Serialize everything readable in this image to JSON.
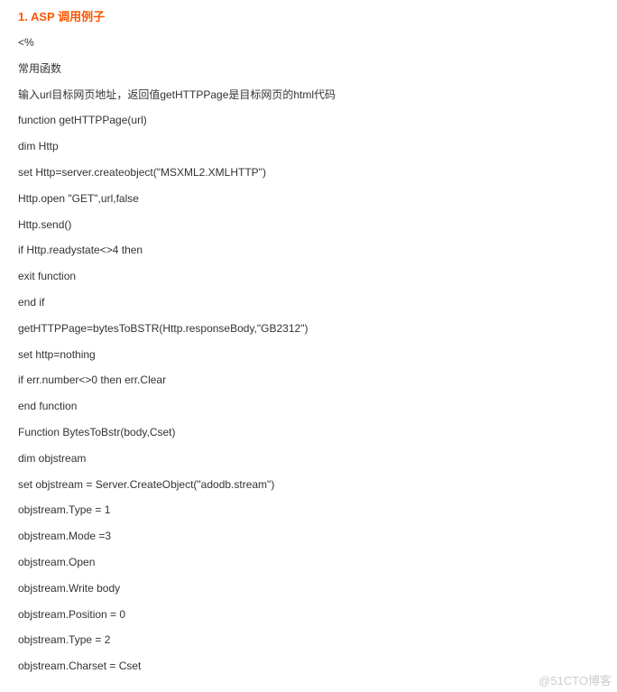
{
  "heading": "1. ASP 调用例子",
  "lines": [
    "<%",
    "常用函数",
    "输入url目标网页地址，返回值getHTTPPage是目标网页的html代码",
    "function getHTTPPage(url)",
    "dim Http",
    "set Http=server.createobject(\"MSXML2.XMLHTTP\")",
    "Http.open \"GET\",url,false",
    "Http.send()",
    "if Http.readystate<>4 then",
    "exit function",
    "end if",
    "getHTTPPage=bytesToBSTR(Http.responseBody,\"GB2312\")",
    "set http=nothing",
    "if err.number<>0 then err.Clear",
    "end function",
    "Function BytesToBstr(body,Cset)",
    "dim objstream",
    "set objstream = Server.CreateObject(\"adodb.stream\")",
    "objstream.Type = 1",
    "objstream.Mode =3",
    "objstream.Open",
    "objstream.Write body",
    "objstream.Position = 0",
    "objstream.Type = 2",
    "objstream.Charset = Cset"
  ],
  "watermark": "@51CTO博客"
}
